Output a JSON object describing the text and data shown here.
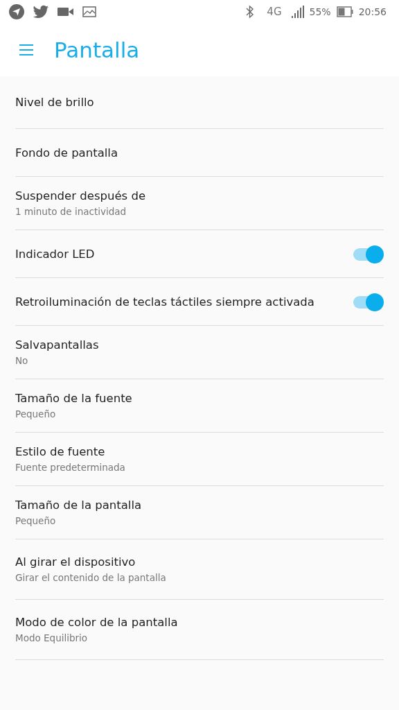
{
  "status_bar": {
    "network": "4G",
    "battery": "55%",
    "time": "20:56"
  },
  "header": {
    "title": "Pantalla"
  },
  "settings": [
    {
      "kind": "plain",
      "title": "Nivel de brillo"
    },
    {
      "kind": "plain",
      "title": "Fondo de pantalla"
    },
    {
      "kind": "plain",
      "title": "Suspender después de",
      "subtitle": "1 minuto de inactividad"
    },
    {
      "kind": "switch",
      "title": "Indicador LED",
      "on": true
    },
    {
      "kind": "switch",
      "title": "Retroiluminación de teclas táctiles siempre activada",
      "on": true
    },
    {
      "kind": "plain",
      "title": "Salvapantallas",
      "subtitle": "No"
    },
    {
      "kind": "plain",
      "title": "Tamaño de la fuente",
      "subtitle": "Pequeño"
    },
    {
      "kind": "plain",
      "title": "Estilo de fuente",
      "subtitle": "Fuente predeterminada"
    },
    {
      "kind": "plain",
      "title": "Tamaño de la pantalla",
      "subtitle": "Pequeño"
    },
    {
      "kind": "plain",
      "title": "Al girar el dispositivo",
      "subtitle": "Girar el contenido de la pantalla"
    },
    {
      "kind": "plain",
      "title": "Modo de color de la pantalla",
      "subtitle": "Modo Equilibrio"
    }
  ]
}
